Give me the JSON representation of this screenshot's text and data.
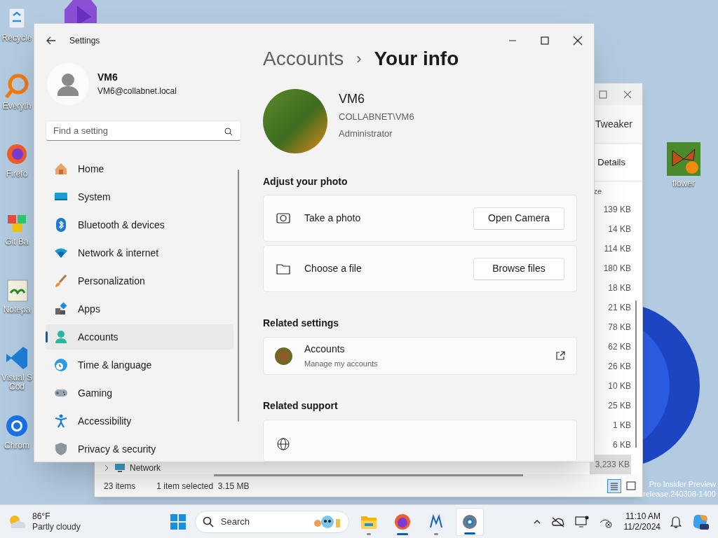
{
  "desktop_icons": [
    {
      "label": "Recycle"
    },
    {
      "label": "Everyth"
    },
    {
      "label": "Firefo"
    },
    {
      "label": "Git Ba"
    },
    {
      "label": "Notepa"
    },
    {
      "label": "Visual S Cod"
    },
    {
      "label": "Chrom"
    }
  ],
  "desktop_file": {
    "label": "flower"
  },
  "watermark": [
    "Pro Insider Preview",
    "release.240308-1400"
  ],
  "explorer": {
    "toolbar_text": "Tweaker",
    "view_label": "Details",
    "column_header": "ze",
    "sizes": [
      "139 KB",
      "14 KB",
      "114 KB",
      "180 KB",
      "18 KB",
      "21 KB",
      "78 KB",
      "62 KB",
      "26 KB",
      "10 KB",
      "25 KB",
      "1 KB",
      "6 KB"
    ],
    "selected_size": "3,233 KB",
    "nav_item": "Network",
    "status": [
      "23 items",
      "1 item selected  3.15 MB"
    ]
  },
  "settings": {
    "title": "Settings",
    "user": {
      "name": "VM6",
      "email": "VM6@collabnet.local"
    },
    "search": {
      "placeholder": "Find a setting"
    },
    "nav": [
      {
        "label": "Home",
        "selected": false
      },
      {
        "label": "System",
        "selected": false
      },
      {
        "label": "Bluetooth & devices",
        "selected": false
      },
      {
        "label": "Network & internet",
        "selected": false
      },
      {
        "label": "Personalization",
        "selected": false
      },
      {
        "label": "Apps",
        "selected": false
      },
      {
        "label": "Accounts",
        "selected": true
      },
      {
        "label": "Time & language",
        "selected": false
      },
      {
        "label": "Gaming",
        "selected": false
      },
      {
        "label": "Accessibility",
        "selected": false
      },
      {
        "label": "Privacy & security",
        "selected": false
      }
    ],
    "breadcrumb": {
      "parent": "Accounts",
      "separator": "›",
      "current": "Your info"
    },
    "profile": {
      "name": "VM6",
      "account": "COLLABNET\\VM6",
      "role": "Administrator"
    },
    "adjust_heading": "Adjust your photo",
    "photo_options": [
      {
        "label": "Take a photo",
        "button": "Open Camera"
      },
      {
        "label": "Choose a file",
        "button": "Browse files"
      }
    ],
    "related_settings_heading": "Related settings",
    "related_settings": [
      {
        "title": "Accounts",
        "subtitle": "Manage my accounts"
      }
    ],
    "related_support_heading": "Related support"
  },
  "taskbar": {
    "weather": {
      "temp": "86°F",
      "condition": "Partly cloudy"
    },
    "search_label": "Search",
    "apps": [
      {
        "accent": false,
        "selected": false
      },
      {
        "accent": true,
        "selected": false
      },
      {
        "accent": false,
        "selected": false
      },
      {
        "accent": true,
        "selected": true
      }
    ],
    "time": "11:10 AM",
    "date": "11/2/2024"
  }
}
